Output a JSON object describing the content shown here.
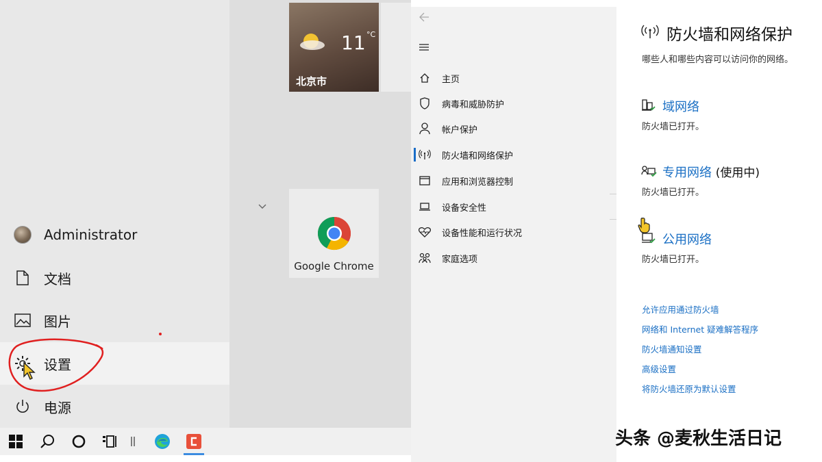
{
  "start_menu": {
    "user": "Administrator",
    "items": [
      {
        "label": "文档",
        "icon": "document-icon"
      },
      {
        "label": "图片",
        "icon": "picture-icon"
      },
      {
        "label": "设置",
        "icon": "gear-icon"
      },
      {
        "label": "电源",
        "icon": "power-icon"
      }
    ],
    "tiles": {
      "weather": {
        "temp": "11",
        "unit": "°C",
        "city": "北京市"
      },
      "chrome": {
        "label": "Google Chrome"
      }
    }
  },
  "taskbar": {
    "buttons": [
      "windows-start-icon",
      "search-icon",
      "cortana-icon",
      "task-view-icon",
      "edge-icon",
      "app-icon"
    ]
  },
  "security_nav": {
    "items": [
      {
        "label": "主页",
        "icon": "home-icon"
      },
      {
        "label": "病毒和威胁防护",
        "icon": "shield-icon"
      },
      {
        "label": "帐户保护",
        "icon": "person-icon"
      },
      {
        "label": "防火墙和网络保护",
        "icon": "antenna-icon",
        "selected": true
      },
      {
        "label": "应用和浏览器控制",
        "icon": "browser-window-icon"
      },
      {
        "label": "设备安全性",
        "icon": "laptop-icon"
      },
      {
        "label": "设备性能和运行状况",
        "icon": "heart-icon"
      },
      {
        "label": "家庭选项",
        "icon": "family-icon"
      }
    ]
  },
  "firewall": {
    "title": "防火墙和网络保护",
    "description": "哪些人和哪些内容可以访问你的网络。",
    "networks": [
      {
        "name": "域网络",
        "suffix": "",
        "status": "防火墙已打开。"
      },
      {
        "name": "专用网络",
        "suffix": "(使用中)",
        "status": "防火墙已打开。"
      },
      {
        "name": "公用网络",
        "suffix": "",
        "status": "防火墙已打开。"
      }
    ],
    "links": [
      "允许应用通过防火墙",
      "网络和 Internet 疑难解答程序",
      "防火墙通知设置",
      "高级设置",
      "将防火墙还原为默认设置"
    ]
  },
  "watermark": "头条 @麦秋生活日记",
  "colors": {
    "accent": "#1a6fc4",
    "annotation": "#e02020"
  }
}
